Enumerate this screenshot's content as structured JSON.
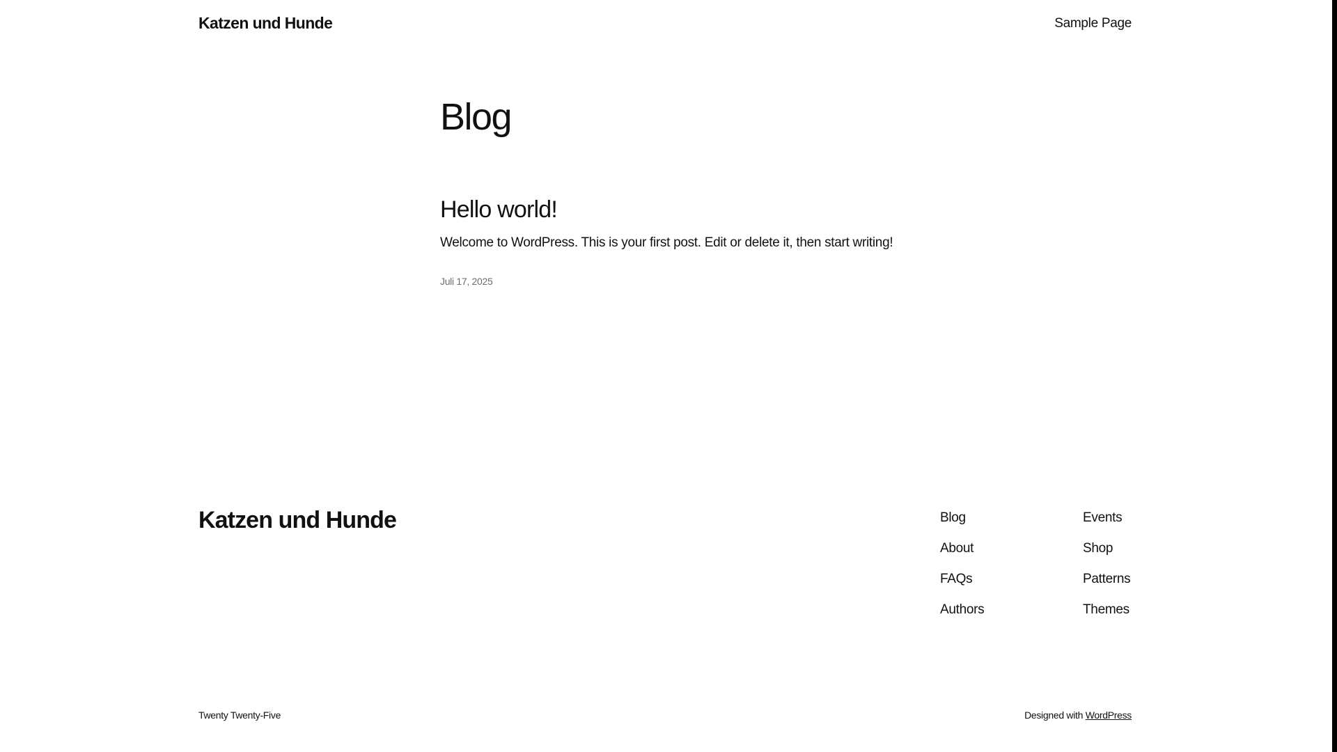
{
  "header": {
    "site_title": "Katzen und Hunde",
    "nav": [
      "Sample Page"
    ]
  },
  "main": {
    "page_title": "Blog",
    "posts": [
      {
        "title": "Hello world!",
        "excerpt": "Welcome to WordPress. This is your first post. Edit or delete it, then start writing!",
        "date": "Juli 17, 2025"
      }
    ]
  },
  "footer": {
    "site_title": "Katzen und Hunde",
    "nav_col_1": [
      "Blog",
      "About",
      "FAQs",
      "Authors"
    ],
    "nav_col_2": [
      "Events",
      "Shop",
      "Patterns",
      "Themes"
    ],
    "theme_credit": "Twenty Twenty-Five",
    "designed_with_prefix": "Designed with",
    "designed_with_link": "WordPress"
  }
}
